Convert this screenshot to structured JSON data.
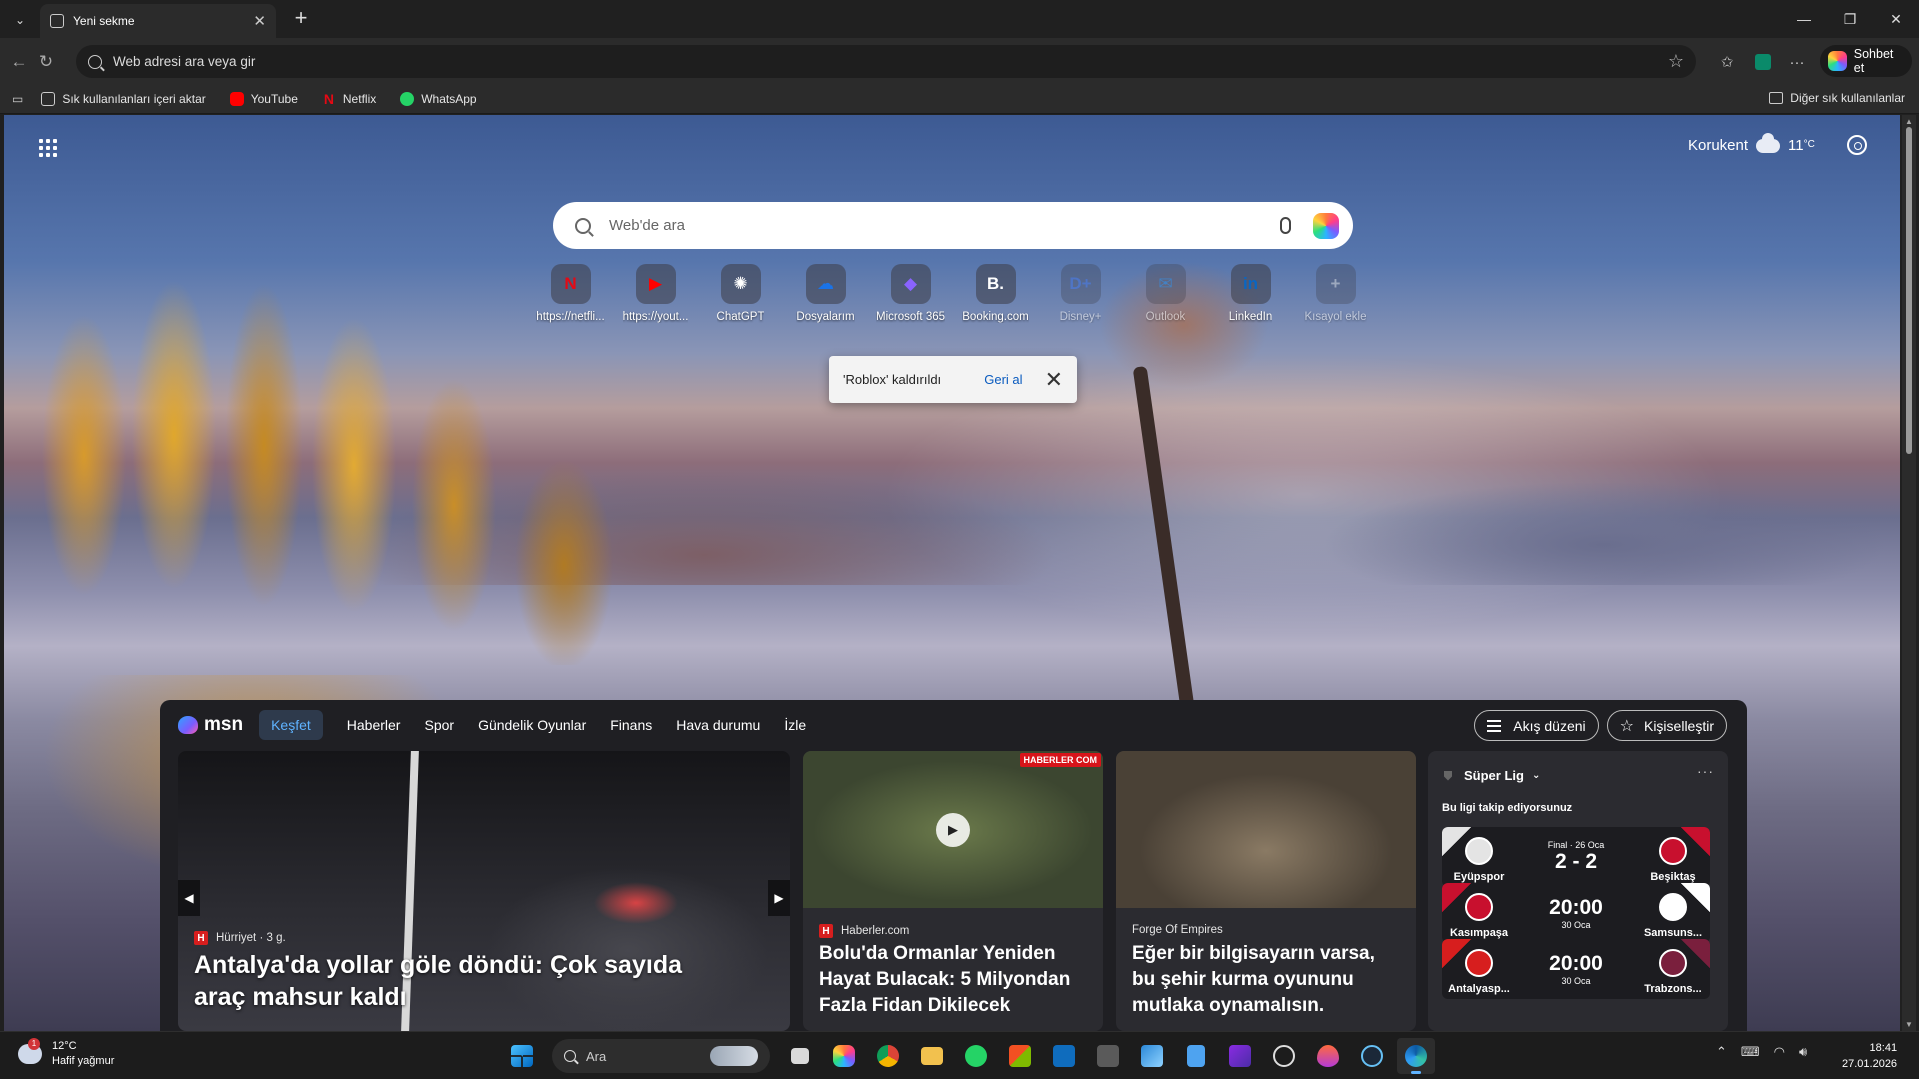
{
  "browser": {
    "tab_title": "Yeni sekme",
    "address_placeholder": "Web adresi ara veya gir",
    "copilot_label": "Sohbet et"
  },
  "favorites": {
    "import_label": "Sık kullanılanları içeri aktar",
    "items": [
      {
        "label": "YouTube",
        "color": "#ff0000"
      },
      {
        "label": "Netflix",
        "color": "#e50914"
      },
      {
        "label": "WhatsApp",
        "color": "#25d366"
      }
    ],
    "other_label": "Diğer sık kullanılanlar"
  },
  "newtab": {
    "weather": {
      "location": "Korukent",
      "temp": "11",
      "unit": "°C"
    },
    "search_placeholder": "Web'de ara",
    "shortcuts": [
      {
        "label": "https://netfli...",
        "glyph": "N",
        "color": "#e50914",
        "faded": false
      },
      {
        "label": "https://yout...",
        "glyph": "▶",
        "color": "#ff0000",
        "faded": false
      },
      {
        "label": "ChatGPT",
        "glyph": "✺",
        "color": "#ffffff",
        "faded": false
      },
      {
        "label": "Dosyalarım",
        "glyph": "☁",
        "color": "#1a73e8",
        "faded": false
      },
      {
        "label": "Microsoft 365",
        "glyph": "◆",
        "color": "#8a63ff",
        "faded": false
      },
      {
        "label": "Booking.com",
        "glyph": "B.",
        "color": "#ffffff",
        "faded": false
      },
      {
        "label": "Disney+",
        "glyph": "D+",
        "color": "#3f6fd8",
        "faded": true
      },
      {
        "label": "Outlook",
        "glyph": "✉",
        "color": "#1e88e5",
        "faded": true
      },
      {
        "label": "LinkedIn",
        "glyph": "in",
        "color": "#0a66c2",
        "faded": false
      },
      {
        "label": "Kısayol ekle",
        "glyph": "+",
        "color": "#cccccc",
        "faded": true
      }
    ],
    "toast": {
      "message": "'Roblox' kaldırıldı",
      "undo": "Geri al"
    }
  },
  "feed": {
    "logo": "msn",
    "tabs": [
      "Keşfet",
      "Haberler",
      "Spor",
      "Gündelik Oyunlar",
      "Finans",
      "Hava durumu",
      "İzle"
    ],
    "layout_button": "Akış düzeni",
    "personalize_button": "Kişiselleştir",
    "cards": [
      {
        "source": "Hürriyet",
        "age": "· 3 g.",
        "source_glyph": "H",
        "title": "Antalya'da yollar göle döndü: Çok sayıda araç mahsur kaldı"
      },
      {
        "source": "Haberler.com",
        "source_glyph": "H",
        "badge": "HABERLER COM",
        "title": "Bolu'da Ormanlar Yeniden Hayat Bulacak: 5 Milyondan Fazla Fidan Dikilecek"
      },
      {
        "source": "Forge Of Empires",
        "title": "Eğer bir bilgisayarın varsa, bu şehir kurma oyununu mutlaka oynamalısın."
      }
    ],
    "sports": {
      "league": "Süper Lig",
      "following": "Bu ligi takip ediyorsunuz",
      "matches": [
        {
          "home": "Eyüpspor",
          "away": "Beşiktaş",
          "top": "Final · 26 Oca",
          "center": "2 - 2",
          "bottom": "",
          "home_color": "#e4e4e4",
          "away_color": "#c8102e"
        },
        {
          "home": "Kasımpaşa",
          "away": "Samsuns...",
          "top": "",
          "center": "20:00",
          "bottom": "30 Oca",
          "home_color": "#c8102e",
          "away_color": "#ffffff"
        },
        {
          "home": "Antalyasp...",
          "away": "Trabzons...",
          "top": "",
          "center": "20:00",
          "bottom": "30 Oca",
          "home_color": "#d71e1e",
          "away_color": "#7a1f3d"
        }
      ]
    }
  },
  "taskbar": {
    "weather_temp": "12°C",
    "weather_desc": "Hafif yağmur",
    "weather_badge": "1",
    "search_label": "Ara",
    "time": "18:41",
    "date": "27.01.2026"
  }
}
